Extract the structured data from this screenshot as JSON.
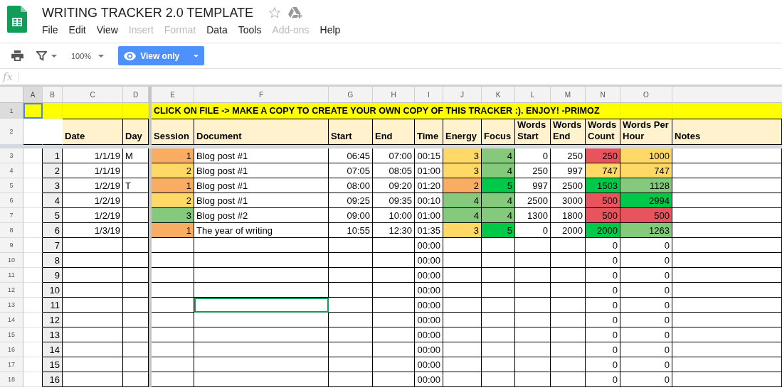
{
  "document": {
    "title": "WRITING TRACKER 2.0 TEMPLATE"
  },
  "menu": [
    {
      "label": "File",
      "disabled": false
    },
    {
      "label": "Edit",
      "disabled": false
    },
    {
      "label": "View",
      "disabled": false
    },
    {
      "label": "Insert",
      "disabled": true
    },
    {
      "label": "Format",
      "disabled": true
    },
    {
      "label": "Data",
      "disabled": false
    },
    {
      "label": "Tools",
      "disabled": false
    },
    {
      "label": "Add-ons",
      "disabled": true
    },
    {
      "label": "Help",
      "disabled": false
    }
  ],
  "toolbar": {
    "zoom": "100%",
    "mode_button": "View only"
  },
  "formula_bar": {
    "label": "fx"
  },
  "columns": [
    {
      "letter": "A",
      "selected": true
    },
    {
      "letter": "B",
      "selected": false
    },
    {
      "letter": "C",
      "selected": false
    },
    {
      "letter": "D",
      "selected": false
    },
    {
      "letter": "E",
      "selected": false
    },
    {
      "letter": "F",
      "selected": false
    },
    {
      "letter": "G",
      "selected": false
    },
    {
      "letter": "H",
      "selected": false
    },
    {
      "letter": "I",
      "selected": false
    },
    {
      "letter": "J",
      "selected": false
    },
    {
      "letter": "K",
      "selected": false
    },
    {
      "letter": "L",
      "selected": false
    },
    {
      "letter": "M",
      "selected": false
    },
    {
      "letter": "N",
      "selected": false
    },
    {
      "letter": "O",
      "selected": false
    }
  ],
  "banner_row": {
    "num": "1",
    "selected": true,
    "cells_left": [
      {
        "color": "#ffff00",
        "cursor": {
          "color": "#4a86e8"
        }
      },
      {
        "color": "#ffff00"
      },
      {
        "color": "#ffff00"
      },
      {
        "color": "#ffff00"
      }
    ],
    "banner": {
      "text": "CLICK ON FILE -> MAKE A COPY TO CREATE YOUR OWN COPY OF THIS TRACKER :). ENJOY! -PRIMOZ",
      "color": "#ffff00"
    },
    "cells_right": [
      {
        "color": "#ffff00"
      },
      {
        "color": "#ffff00"
      }
    ]
  },
  "header_row": {
    "num": "2",
    "selected": false,
    "cells": [
      null,
      null,
      {
        "text": "Date",
        "color": "#fff2cc"
      },
      {
        "text": "Day",
        "color": "#fff2cc"
      },
      {
        "text": "Session",
        "color": "#fff2cc"
      },
      {
        "text": "Document",
        "color": "#fff2cc"
      },
      {
        "text": "Start",
        "color": "#fff2cc"
      },
      {
        "text": "End",
        "color": "#fff2cc"
      },
      {
        "text": "Time",
        "color": "#fff2cc"
      },
      {
        "text": "Energy",
        "color": "#fff2cc"
      },
      {
        "text": "Focus",
        "color": "#fff2cc"
      },
      {
        "text": "Words Start",
        "color": "#fff2cc"
      },
      {
        "text": "Words End",
        "color": "#fff2cc"
      },
      {
        "text": "Words Count",
        "color": "#fff2cc"
      },
      {
        "text": "Words Per Hour",
        "color": "#fff2cc"
      },
      {
        "text": "Notes",
        "color": "#fff2cc"
      }
    ]
  },
  "rows": [
    {
      "num": "3",
      "selected": false,
      "cells": [
        null,
        {
          "text": "1",
          "color": "#eeeeee"
        },
        "1/1/19",
        "M",
        {
          "text": "1",
          "color": "#f9ad62"
        },
        "Blog post #1",
        "06:45",
        "07:00",
        "00:15",
        {
          "text": "3",
          "color": "#ffd966"
        },
        {
          "text": "4",
          "color": "#85c97d"
        },
        "0",
        "250",
        {
          "text": "250",
          "color": "#e8545e"
        },
        {
          "text": "1000",
          "color": "#ffd966"
        },
        null
      ]
    },
    {
      "num": "4",
      "selected": false,
      "cells": [
        null,
        {
          "text": "2",
          "color": "#eeeeee"
        },
        "1/1/19",
        null,
        {
          "text": "2",
          "color": "#ffd966"
        },
        "Blog post #1",
        "07:05",
        "08:05",
        "01:00",
        {
          "text": "3",
          "color": "#ffd966"
        },
        {
          "text": "4",
          "color": "#85c97d"
        },
        "250",
        "997",
        {
          "text": "747",
          "color": "#ffd966"
        },
        {
          "text": "747",
          "color": "#ffd966"
        },
        null
      ]
    },
    {
      "num": "5",
      "selected": false,
      "cells": [
        null,
        {
          "text": "3",
          "color": "#eeeeee"
        },
        "1/2/19",
        "T",
        {
          "text": "1",
          "color": "#f9ad62"
        },
        "Blog post #1",
        "08:00",
        "09:20",
        "01:20",
        {
          "text": "2",
          "color": "#f9ad62"
        },
        {
          "text": "5",
          "color": "#00c94a"
        },
        "997",
        "2500",
        {
          "text": "1503",
          "color": "#00c94a"
        },
        {
          "text": "1128",
          "color": "#85c97d"
        },
        null
      ]
    },
    {
      "num": "6",
      "selected": false,
      "cells": [
        null,
        {
          "text": "4",
          "color": "#eeeeee"
        },
        "1/2/19",
        null,
        {
          "text": "2",
          "color": "#ffd966"
        },
        "Blog post #1",
        "09:25",
        "09:35",
        "00:10",
        {
          "text": "4",
          "color": "#85c97d"
        },
        {
          "text": "4",
          "color": "#85c97d"
        },
        "2500",
        "3000",
        {
          "text": "500",
          "color": "#e8545e"
        },
        {
          "text": "2994",
          "color": "#00c94a"
        },
        null
      ]
    },
    {
      "num": "7",
      "selected": false,
      "cells": [
        null,
        {
          "text": "5",
          "color": "#eeeeee"
        },
        "1/2/19",
        null,
        {
          "text": "3",
          "color": "#85c97d"
        },
        "Blog post #2",
        "09:00",
        "10:00",
        "01:00",
        {
          "text": "4",
          "color": "#85c97d"
        },
        {
          "text": "4",
          "color": "#85c97d"
        },
        "1300",
        "1800",
        {
          "text": "500",
          "color": "#e8545e"
        },
        {
          "text": "500",
          "color": "#e8545e"
        },
        null
      ]
    },
    {
      "num": "8",
      "selected": false,
      "cells": [
        null,
        {
          "text": "6",
          "color": "#eeeeee"
        },
        "1/3/19",
        null,
        {
          "text": "1",
          "color": "#f9ad62"
        },
        "The year of writing",
        "10:55",
        "12:30",
        "01:35",
        {
          "text": "3",
          "color": "#ffd966"
        },
        {
          "text": "5",
          "color": "#00c94a"
        },
        "0",
        "2000",
        {
          "text": "2000",
          "color": "#00c94a"
        },
        {
          "text": "1263",
          "color": "#85c97d"
        },
        null
      ]
    },
    {
      "num": "9",
      "selected": false,
      "cells": [
        null,
        {
          "text": "7",
          "color": "#eeeeee"
        },
        null,
        null,
        null,
        null,
        null,
        null,
        "00:00",
        null,
        null,
        null,
        null,
        "0",
        "0",
        null
      ]
    },
    {
      "num": "10",
      "selected": false,
      "cells": [
        null,
        {
          "text": "8",
          "color": "#eeeeee"
        },
        null,
        null,
        null,
        null,
        null,
        null,
        "00:00",
        null,
        null,
        null,
        null,
        "0",
        "0",
        null
      ]
    },
    {
      "num": "11",
      "selected": false,
      "cells": [
        null,
        {
          "text": "9",
          "color": "#eeeeee"
        },
        null,
        null,
        null,
        null,
        null,
        null,
        "00:00",
        null,
        null,
        null,
        null,
        "0",
        "0",
        null
      ]
    },
    {
      "num": "12",
      "selected": false,
      "cells": [
        null,
        {
          "text": "10",
          "color": "#eeeeee"
        },
        null,
        null,
        null,
        null,
        null,
        null,
        "00:00",
        null,
        null,
        null,
        null,
        "0",
        "0",
        null
      ]
    },
    {
      "num": "13",
      "selected": false,
      "cells": [
        null,
        {
          "text": "11",
          "color": "#eeeeee"
        },
        null,
        null,
        null,
        {
          "cursor": {
            "color": "#0f9d58"
          }
        },
        null,
        null,
        "00:00",
        null,
        null,
        null,
        null,
        "0",
        "0",
        null
      ]
    },
    {
      "num": "14",
      "selected": false,
      "cells": [
        null,
        {
          "text": "12",
          "color": "#eeeeee"
        },
        null,
        null,
        null,
        null,
        null,
        null,
        "00:00",
        null,
        null,
        null,
        null,
        "0",
        "0",
        null
      ]
    },
    {
      "num": "15",
      "selected": false,
      "cells": [
        null,
        {
          "text": "13",
          "color": "#eeeeee"
        },
        null,
        null,
        null,
        null,
        null,
        null,
        "00:00",
        null,
        null,
        null,
        null,
        "0",
        "0",
        null
      ]
    },
    {
      "num": "16",
      "selected": false,
      "cells": [
        null,
        {
          "text": "14",
          "color": "#eeeeee"
        },
        null,
        null,
        null,
        null,
        null,
        null,
        "00:00",
        null,
        null,
        null,
        null,
        "0",
        "0",
        null
      ]
    },
    {
      "num": "17",
      "selected": false,
      "cells": [
        null,
        {
          "text": "15",
          "color": "#eeeeee"
        },
        null,
        null,
        null,
        null,
        null,
        null,
        "00:00",
        null,
        null,
        null,
        null,
        "0",
        "0",
        null
      ]
    },
    {
      "num": "18",
      "selected": false,
      "cells": [
        null,
        {
          "text": "16",
          "color": "#eeeeee"
        },
        null,
        null,
        null,
        null,
        null,
        null,
        "00:00",
        null,
        null,
        null,
        null,
        "0",
        "0",
        null
      ]
    }
  ]
}
